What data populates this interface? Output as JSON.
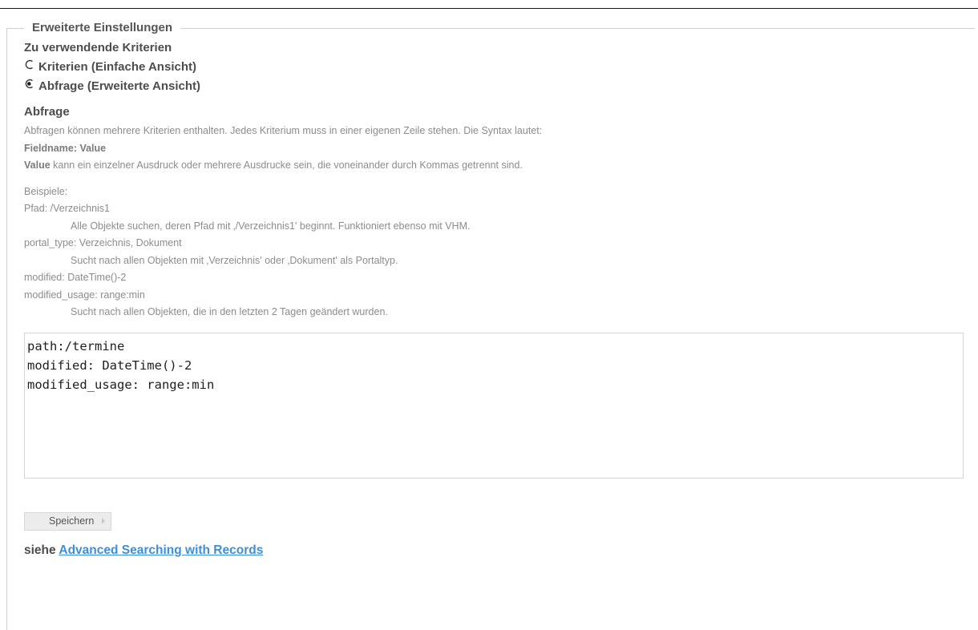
{
  "fieldset": {
    "legend": "Erweiterte Einstellungen"
  },
  "criteria": {
    "label": "Zu verwendende Kriterien",
    "options": [
      {
        "label": "Kriterien (Einfache Ansicht)",
        "checked": false
      },
      {
        "label": "Abfrage (Erweiterte Ansicht)",
        "checked": true
      }
    ]
  },
  "query": {
    "label": "Abfrage",
    "help_intro": "Abfragen können mehrere Kriterien enthalten. Jedes Kriterium muss in einer eigenen Zeile stehen. Die Syntax lautet:",
    "syntax_line": "Fieldname: Value",
    "value_term": "Value",
    "value_desc": " kann ein einzelner Ausdruck oder mehrere Ausdrucke sein, die voneinander durch Kommas getrennt sind.",
    "examples_heading": "Beispiele:",
    "examples": [
      {
        "code": "Pfad: /Verzeichnis1",
        "desc": "Alle Objekte suchen, deren Pfad mit ‚/Verzeichnis1' beginnt. Funktioniert ebenso mit VHM."
      },
      {
        "code": "portal_type: Verzeichnis, Dokument",
        "desc": "Sucht nach allen Objekten mit ‚Verzeichnis' oder ‚Dokument' als Portaltyp."
      },
      {
        "code": "modified: DateTime()-2",
        "desc": ""
      },
      {
        "code": "modified_usage: range:min",
        "desc": "Sucht nach allen Objekten, die in den letzten 2 Tagen geändert wurden."
      }
    ],
    "value": "path:/termine\nmodified: DateTime()-2\nmodified_usage: range:min"
  },
  "actions": {
    "save_label": "Speichern"
  },
  "see_also": {
    "prefix": "siehe",
    "link_text": "Advanced Searching with Records"
  },
  "colors": {
    "link": "#3d8fd9",
    "help_text": "#8c8c8c",
    "label_text": "#4d4d4d"
  }
}
